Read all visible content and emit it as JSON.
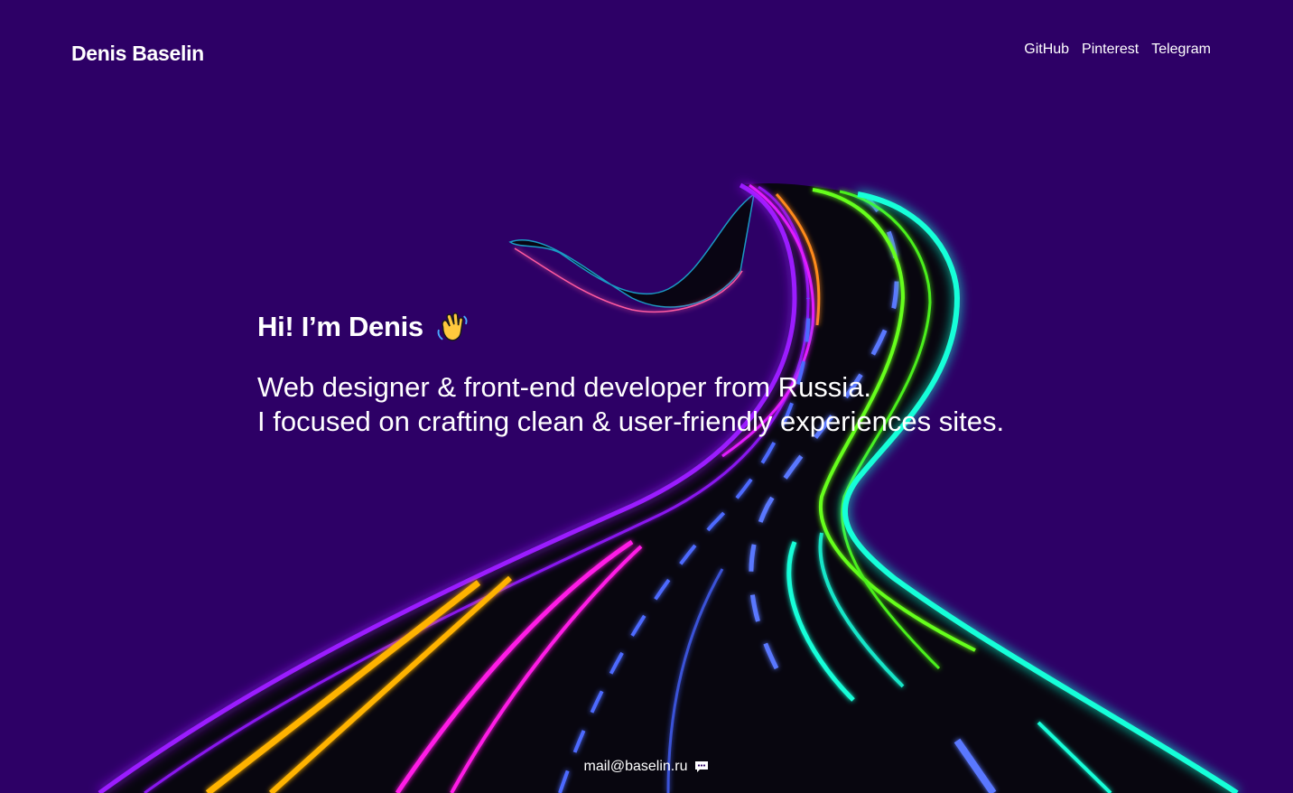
{
  "header": {
    "logo": "Denis Baselin",
    "nav": [
      {
        "label": "GitHub"
      },
      {
        "label": "Pinterest"
      },
      {
        "label": "Telegram"
      }
    ]
  },
  "hero": {
    "greeting": "Hi! I’m Denis",
    "greeting_icon": "waving-hand-icon",
    "bio_line_1": "Web designer & front-end developer from Russia.",
    "bio_line_2": "I focused on crafting clean & user-friendly experiences sites."
  },
  "footer": {
    "email": "mail@baselin.ru",
    "icon": "chat-bubble-icon"
  },
  "colors": {
    "background": "#2d0066",
    "road": "#08060f",
    "neon_purple": "#9b1dff",
    "neon_magenta": "#ff1ae6",
    "neon_orange": "#ffb300",
    "neon_blue": "#4d6bff",
    "neon_green": "#66ff1a",
    "neon_cyan": "#19ffd9",
    "text": "#ffffff"
  }
}
